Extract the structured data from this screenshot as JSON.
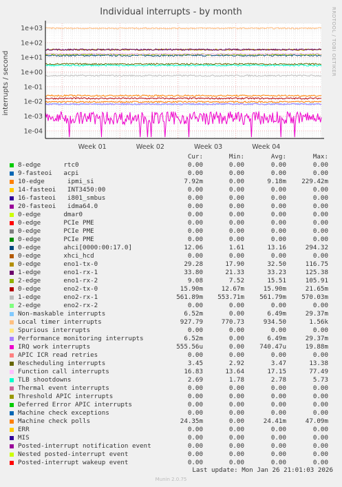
{
  "chart_data": {
    "type": "line",
    "title": "Individual interrupts - by month",
    "ylabel": "interrupts / second",
    "yscale": "log",
    "ylim": [
      3e-05,
      2000
    ],
    "yticks": [
      "1e+03",
      "1e+02",
      "1e+01",
      "1e+00",
      "1e-01",
      "1e-02",
      "1e-03",
      "1e-04"
    ],
    "xticks": [
      "Week 01",
      "Week 02",
      "Week 03",
      "Week 04"
    ],
    "grid": true,
    "columns": [
      "Cur:",
      "Min:",
      "Avg:",
      "Max:"
    ],
    "series": [
      {
        "name": "8-edge      rtc0",
        "color": "#00cc00",
        "cur": "0.00",
        "min": "0.00",
        "avg": "0.00",
        "max": "0.00"
      },
      {
        "name": "9-fasteoi   acpi",
        "color": "#0066b3",
        "cur": "0.00",
        "min": "0.00",
        "avg": "0.00",
        "max": "0.00"
      },
      {
        "name": "10-edge      ipmi_si",
        "color": "#ff8000",
        "cur": "7.92m",
        "min": "0.00",
        "avg": "9.18m",
        "max": "229.42m"
      },
      {
        "name": "14-fasteoi   INT3450:00",
        "color": "#ffcc00",
        "cur": "0.00",
        "min": "0.00",
        "avg": "0.00",
        "max": "0.00"
      },
      {
        "name": "16-fasteoi   i801_smbus",
        "color": "#330099",
        "cur": "0.00",
        "min": "0.00",
        "avg": "0.00",
        "max": "0.00"
      },
      {
        "name": "20-fasteoi   idma64.0",
        "color": "#990099",
        "cur": "0.00",
        "min": "0.00",
        "avg": "0.00",
        "max": "0.00"
      },
      {
        "name": "0-edge      dmar0",
        "color": "#ccff00",
        "cur": "0.00",
        "min": "0.00",
        "avg": "0.00",
        "max": "0.00"
      },
      {
        "name": "0-edge      PCIe PME",
        "color": "#ff0000",
        "cur": "0.00",
        "min": "0.00",
        "avg": "0.00",
        "max": "0.00"
      },
      {
        "name": "0-edge      PCIe PME",
        "color": "#808080",
        "cur": "0.00",
        "min": "0.00",
        "avg": "0.00",
        "max": "0.00"
      },
      {
        "name": "0-edge      PCIe PME",
        "color": "#008f00",
        "cur": "0.00",
        "min": "0.00",
        "avg": "0.00",
        "max": "0.00"
      },
      {
        "name": "0-edge      ahci[0000:00:17.0]",
        "color": "#00487d",
        "cur": "12.06",
        "min": "1.61",
        "avg": "13.16",
        "max": "294.32"
      },
      {
        "name": "0-edge      xhci_hcd",
        "color": "#b35a00",
        "cur": "0.00",
        "min": "0.00",
        "avg": "0.00",
        "max": "0.00"
      },
      {
        "name": "0-edge      eno1-tx-0",
        "color": "#b38f00",
        "cur": "29.28",
        "min": "17.90",
        "avg": "32.50",
        "max": "116.75"
      },
      {
        "name": "1-edge      eno1-rx-1",
        "color": "#6b006b",
        "cur": "33.80",
        "min": "21.33",
        "avg": "33.23",
        "max": "125.38"
      },
      {
        "name": "2-edge      eno1-rx-2",
        "color": "#8fb300",
        "cur": "9.08",
        "min": "7.52",
        "avg": "15.51",
        "max": "105.91"
      },
      {
        "name": "0-edge      eno2-tx-0",
        "color": "#b30000",
        "cur": "15.90m",
        "min": "12.67m",
        "avg": "15.90m",
        "max": "21.65m"
      },
      {
        "name": "1-edge      eno2-rx-1",
        "color": "#bebebe",
        "cur": "561.89m",
        "min": "553.71m",
        "avg": "561.79m",
        "max": "570.03m"
      },
      {
        "name": "2-edge      eno2-rx-2",
        "color": "#80ff80",
        "cur": "0.00",
        "min": "0.00",
        "avg": "0.00",
        "max": "0.00"
      },
      {
        "name": "Non-maskable interrupts",
        "color": "#80c9ff",
        "cur": "6.52m",
        "min": "0.00",
        "avg": "6.49m",
        "max": "29.37m"
      },
      {
        "name": "Local timer interrupts",
        "color": "#ffc080",
        "cur": "927.79",
        "min": "770.73",
        "avg": "934.50",
        "max": "1.56k"
      },
      {
        "name": "Spurious interrupts",
        "color": "#ffe680",
        "cur": "0.00",
        "min": "0.00",
        "avg": "0.00",
        "max": "0.00"
      },
      {
        "name": "Performance monitoring interrupts",
        "color": "#aa80ff",
        "cur": "6.52m",
        "min": "0.00",
        "avg": "6.49m",
        "max": "29.37m"
      },
      {
        "name": "IRQ work interrupts",
        "color": "#ee00cc",
        "cur": "555.56u",
        "min": "0.00",
        "avg": "740.47u",
        "max": "19.88m"
      },
      {
        "name": "APIC ICR read retries",
        "color": "#ff8080",
        "cur": "0.00",
        "min": "0.00",
        "avg": "0.00",
        "max": "0.00"
      },
      {
        "name": "Rescheduling interrupts",
        "color": "#666600",
        "cur": "3.45",
        "min": "2.92",
        "avg": "3.47",
        "max": "13.38"
      },
      {
        "name": "Function call interrupts",
        "color": "#ffbfff",
        "cur": "16.83",
        "min": "13.64",
        "avg": "17.15",
        "max": "77.49"
      },
      {
        "name": "TLB shootdowns",
        "color": "#00ffcc",
        "cur": "2.69",
        "min": "1.78",
        "avg": "2.78",
        "max": "5.73"
      },
      {
        "name": "Thermal event interrupts",
        "color": "#cc6699",
        "cur": "0.00",
        "min": "0.00",
        "avg": "0.00",
        "max": "0.00"
      },
      {
        "name": "Threshold APIC interrupts",
        "color": "#999900",
        "cur": "0.00",
        "min": "0.00",
        "avg": "0.00",
        "max": "0.00"
      },
      {
        "name": "Deferred Error APIC interrupts",
        "color": "#00cc00",
        "cur": "0.00",
        "min": "0.00",
        "avg": "0.00",
        "max": "0.00"
      },
      {
        "name": "Machine check exceptions",
        "color": "#0066b3",
        "cur": "0.00",
        "min": "0.00",
        "avg": "0.00",
        "max": "0.00"
      },
      {
        "name": "Machine check polls",
        "color": "#ff8000",
        "cur": "24.35m",
        "min": "0.00",
        "avg": "24.41m",
        "max": "47.09m"
      },
      {
        "name": "ERR",
        "color": "#ffcc00",
        "cur": "0.00",
        "min": "0.00",
        "avg": "0.00",
        "max": "0.00"
      },
      {
        "name": "MIS",
        "color": "#330099",
        "cur": "0.00",
        "min": "0.00",
        "avg": "0.00",
        "max": "0.00"
      },
      {
        "name": "Posted-interrupt notification event",
        "color": "#990099",
        "cur": "0.00",
        "min": "0.00",
        "avg": "0.00",
        "max": "0.00"
      },
      {
        "name": "Nested posted-interrupt event",
        "color": "#ccff00",
        "cur": "0.00",
        "min": "0.00",
        "avg": "0.00",
        "max": "0.00"
      },
      {
        "name": "Posted-interrupt wakeup event",
        "color": "#ff0000",
        "cur": "0.00",
        "min": "0.00",
        "avg": "0.00",
        "max": "0.00"
      }
    ]
  },
  "side_credit": "RRDTOOL / TOBI OETIKER",
  "last_update": "Last update: Mon Jan 26 21:01:03 2026",
  "footer": "Munin 2.0.75"
}
